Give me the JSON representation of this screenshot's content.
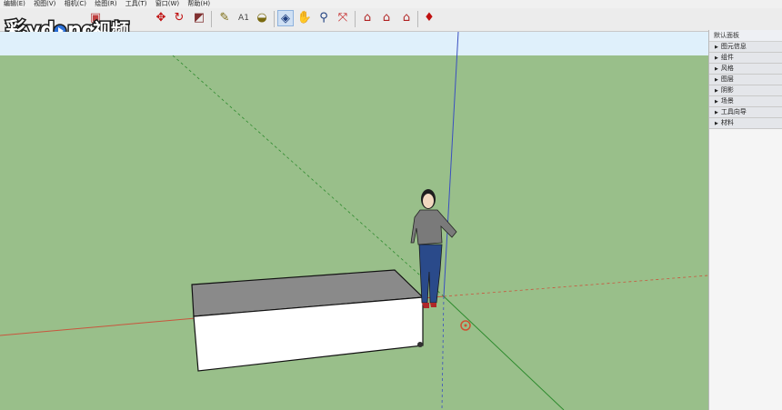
{
  "menu": [
    "编辑(E)",
    "视图(V)",
    "相机(C)",
    "绘图(R)",
    "工具(T)",
    "窗口(W)",
    "帮助(H)"
  ],
  "watermark": "彩视频",
  "toolbar": {
    "icons": [
      "push-pull-icon",
      "move-icon",
      "rotate-icon",
      "scale-icon",
      "tape-measure-icon",
      "text-icon",
      "paint-bucket-icon",
      "orbit-icon",
      "pan-icon",
      "zoom-icon",
      "zoom-extents-icon",
      "warehouse-icon",
      "share-model-icon",
      "extension-warehouse-icon",
      "ruby-icon"
    ]
  },
  "panel": {
    "title": "默认面板",
    "trays": [
      "图元信息",
      "组件",
      "风格",
      "图层",
      "阴影",
      "场景",
      "工具向导",
      "材料"
    ]
  },
  "colors": {
    "sky": "#dff0fb",
    "ground": "#99bf8a",
    "red_axis": "#c9553d",
    "green_axis": "#2e8b2e",
    "blue_axis": "#3a4fc0"
  }
}
